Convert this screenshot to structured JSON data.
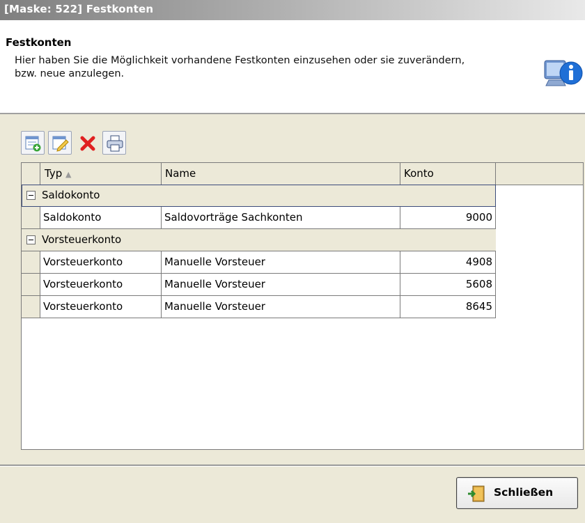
{
  "window": {
    "title": "[Maske: 522] Festkonten"
  },
  "header": {
    "title": "Festkonten",
    "description": "Hier haben Sie die Möglichkeit vorhandene Festkonten einzusehen oder sie zuverändern, bzw. neue anzulegen.",
    "icon": "info-computer-icon"
  },
  "toolbar": {
    "buttons": [
      {
        "icon": "add-record-icon"
      },
      {
        "icon": "edit-record-icon"
      },
      {
        "icon": "delete-icon"
      },
      {
        "icon": "print-icon"
      }
    ]
  },
  "grid": {
    "columns": [
      "Typ",
      "Name",
      "Konto"
    ],
    "sort_indicator": "▲",
    "groups": [
      {
        "label": "Saldokonto",
        "rows": [
          {
            "typ": "Saldokonto",
            "name": "Saldovorträge Sachkonten",
            "konto": "9000"
          }
        ]
      },
      {
        "label": "Vorsteuerkonto",
        "rows": [
          {
            "typ": "Vorsteuerkonto",
            "name": "Manuelle Vorsteuer",
            "konto": "4908"
          },
          {
            "typ": "Vorsteuerkonto",
            "name": "Manuelle Vorsteuer",
            "konto": "5608"
          },
          {
            "typ": "Vorsteuerkonto",
            "name": "Manuelle Vorsteuer",
            "konto": "8645"
          }
        ]
      }
    ]
  },
  "footer": {
    "close_label": "Schließen",
    "close_icon": "exit-door-icon"
  },
  "colors": {
    "titlebar_start": "#7f7f7f",
    "background": "#ece9d8",
    "delete": "#e02020"
  }
}
